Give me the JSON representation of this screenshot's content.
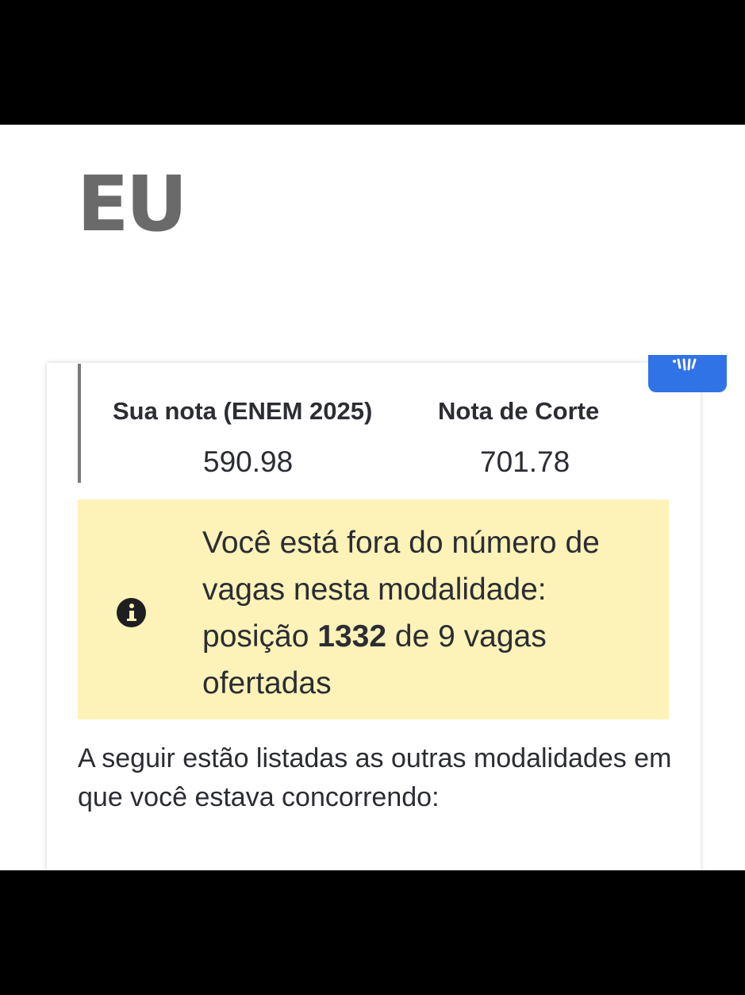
{
  "caption": "EU",
  "scores": {
    "my_score_label": "Sua nota (ENEM 2025)",
    "my_score_value": "590.98",
    "cutoff_label": "Nota de Corte",
    "cutoff_value": "701.78"
  },
  "notice": {
    "line1": "Você está fora do número de vagas nesta modalidade:",
    "position_prefix": "posição",
    "position_value": "1332",
    "position_suffix": "de 9 vagas ofertadas",
    "icon": "info-icon",
    "background": "#fdf2b8"
  },
  "footer": {
    "text": "A seguir estão listadas as outras modalidades em que você estava concorrendo:"
  },
  "floating_button": {
    "icon": "accessibility-icon",
    "color": "#2f73e6"
  }
}
